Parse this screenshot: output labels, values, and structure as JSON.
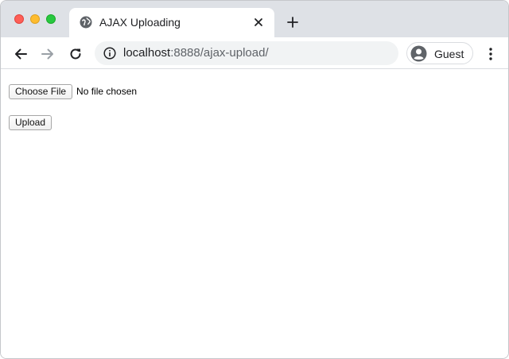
{
  "browser": {
    "tab": {
      "title": "AJAX Uploading",
      "favicon": "globe-icon"
    },
    "address_bar": {
      "host": "localhost",
      "path": ":8888/ajax-upload/"
    },
    "profile": {
      "label": "Guest"
    },
    "colors": {
      "tabstrip": "#dee1e6",
      "close_red": "#fe5f57",
      "minimize_yellow": "#febc2e",
      "maximize_green": "#28c840"
    }
  },
  "page": {
    "file_input": {
      "button_label": "Choose File",
      "status_text": "No file chosen"
    },
    "upload_button_label": "Upload"
  }
}
